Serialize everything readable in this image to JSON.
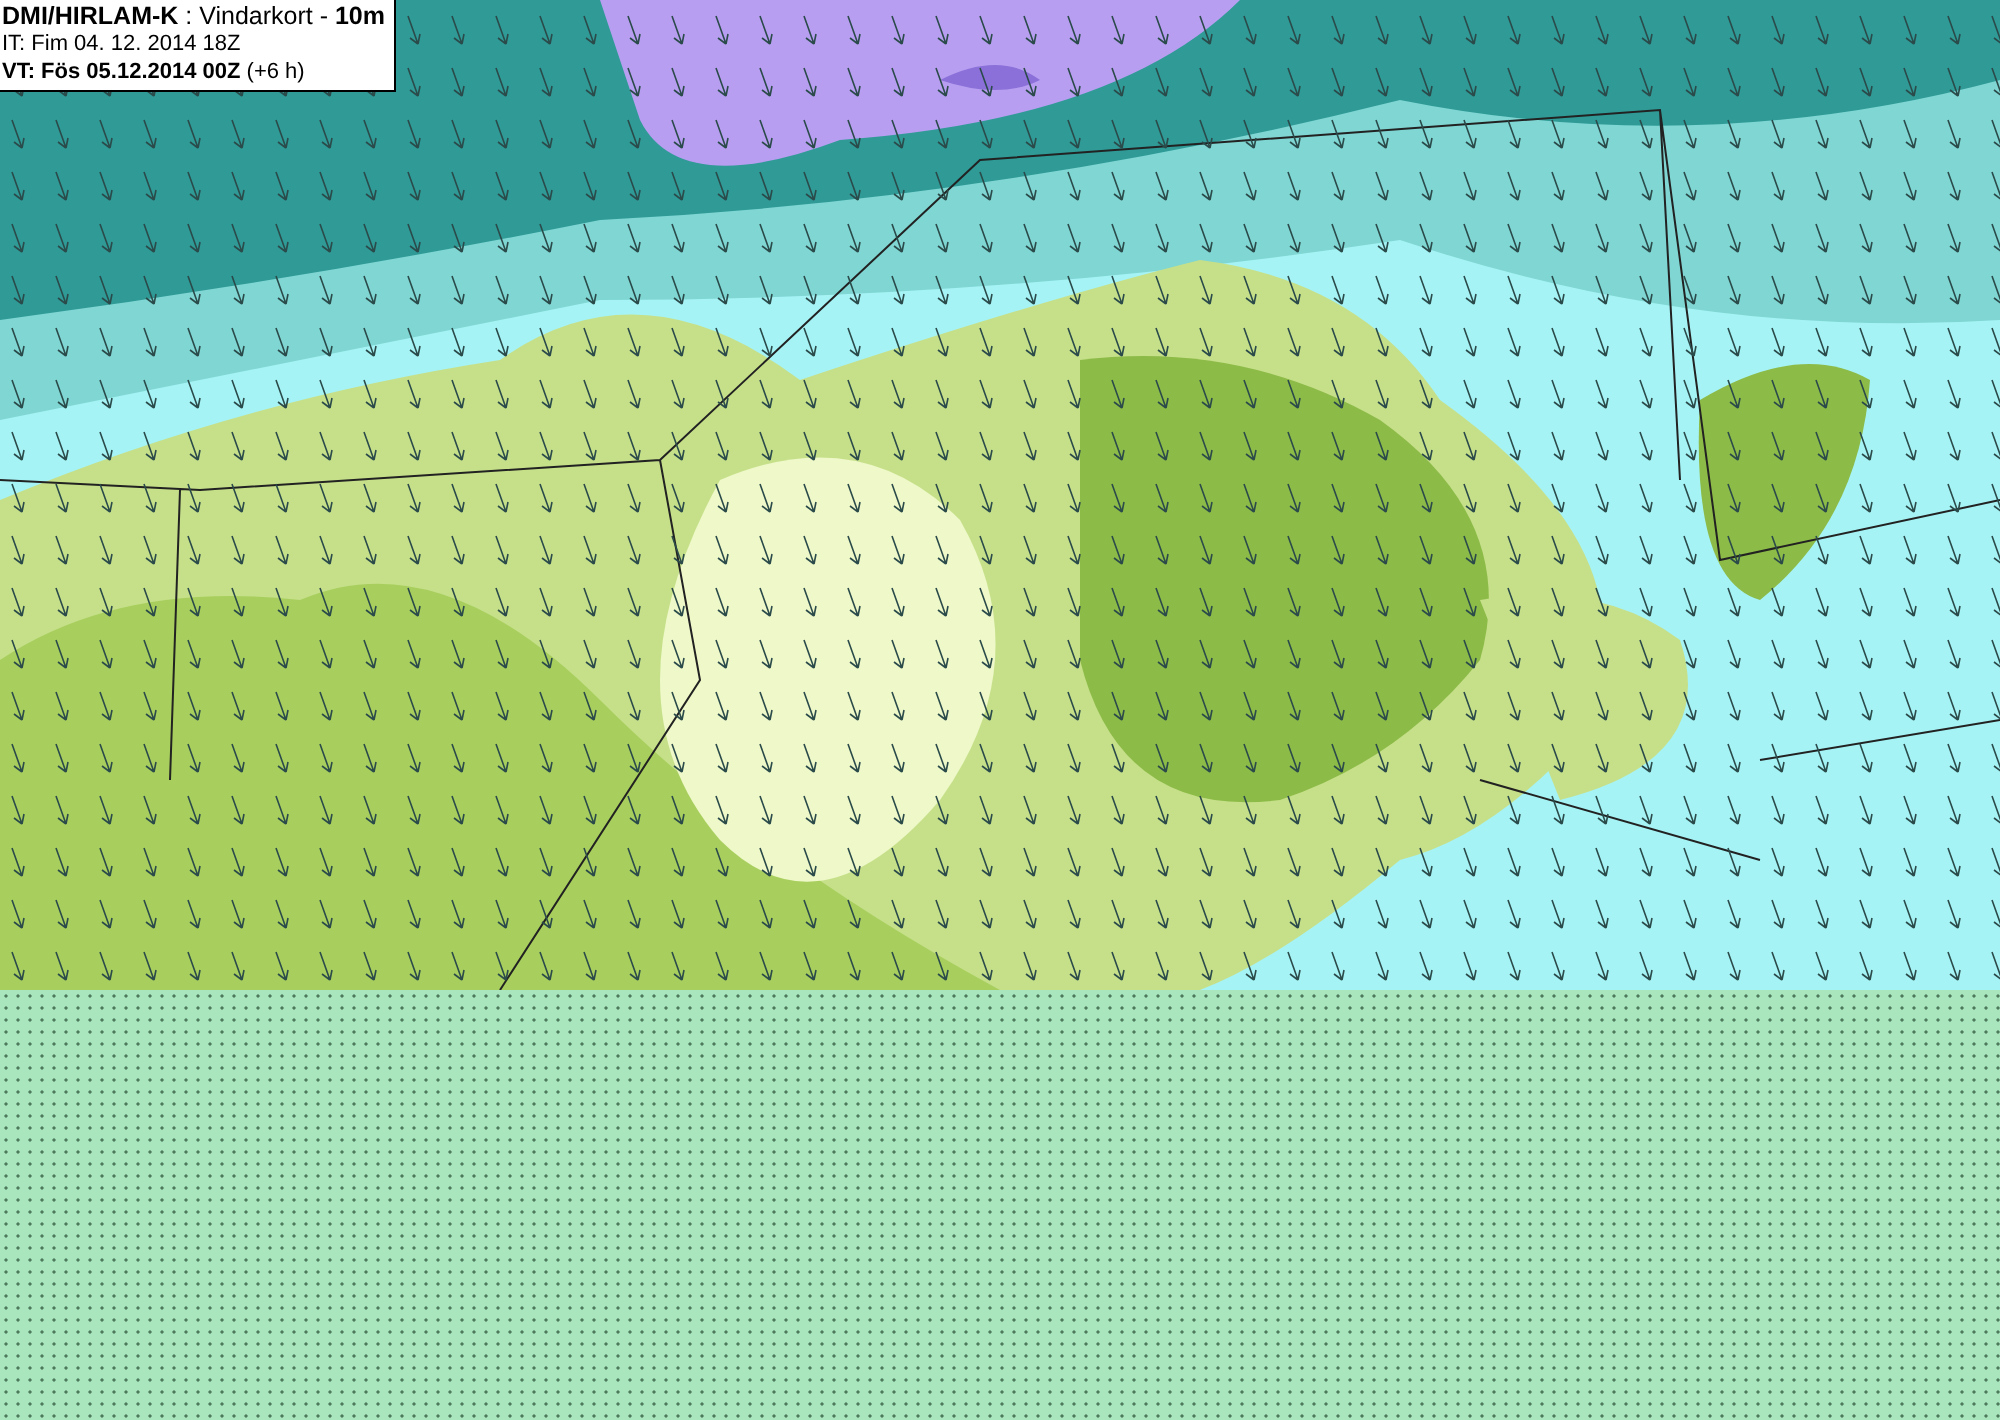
{
  "legend": {
    "lines": [
      "**DMI/HIRLAM-K** : Vindarkort - **10m**",
      "IT: Fim 04. 12. 2014 18Z",
      "**VT: Fös 05.12.2014 00Z** (+6 h)"
    ]
  }
}
